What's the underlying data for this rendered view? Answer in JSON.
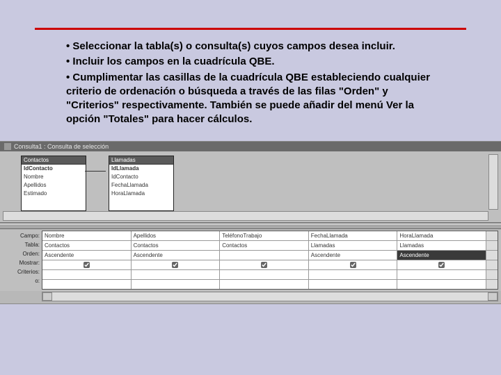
{
  "bullets": [
    "Seleccionar la tabla(s) o consulta(s) cuyos campos desea incluir.",
    "Incluir los campos en la cuadrícula QBE.",
    "Cumplimentar las casillas de la cuadrícula QBE estableciendo cualquier criterio de ordenación o búsqueda a través de las filas \"Orden\" y \"Criterios\" respectivamente. También se puede añadir del menú Ver la opción \"Totales\" para hacer cálculos."
  ],
  "access": {
    "windowTitle": "Consulta1 : Consulta de selección",
    "tables": [
      {
        "name": "Contactos",
        "fields": [
          "IdContacto",
          "Nombre",
          "Apellidos",
          "Estimado"
        ],
        "pkIndex": 0
      },
      {
        "name": "Llamadas",
        "fields": [
          "IdLlamada",
          "IdContacto",
          "FechaLlamada",
          "HoraLlamada"
        ],
        "pkIndex": 0
      }
    ],
    "qbeRowLabels": [
      "Campo:",
      "Tabla:",
      "Orden:",
      "Mostrar:",
      "Criterios:",
      "o:"
    ],
    "columns": [
      {
        "campo": "Nombre",
        "tabla": "Contactos",
        "orden": "Ascendente",
        "mostrar": true,
        "dark": false
      },
      {
        "campo": "Apellidos",
        "tabla": "Contactos",
        "orden": "Ascendente",
        "mostrar": true,
        "dark": false
      },
      {
        "campo": "TeléfonoTrabajo",
        "tabla": "Contactos",
        "orden": "",
        "mostrar": true,
        "dark": false
      },
      {
        "campo": "FechaLlamada",
        "tabla": "Llamadas",
        "orden": "Ascendente",
        "mostrar": true,
        "dark": false
      },
      {
        "campo": "HoraLlamada",
        "tabla": "Llamadas",
        "orden": "Ascendente",
        "mostrar": true,
        "dark": true
      }
    ]
  }
}
